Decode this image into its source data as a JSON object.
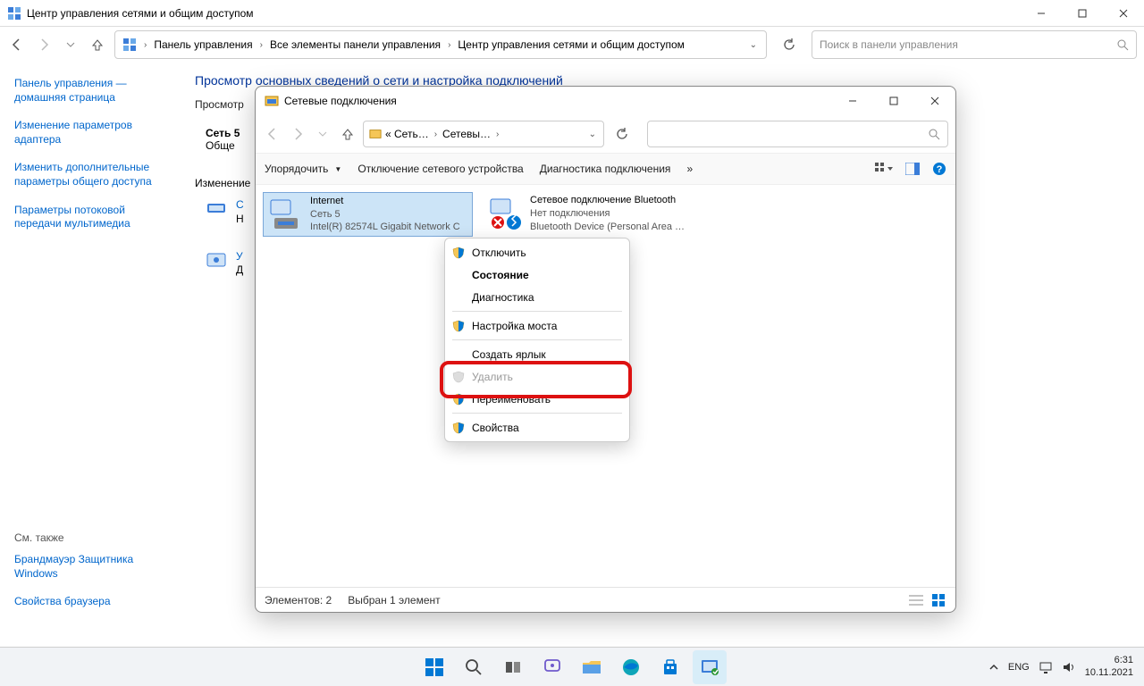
{
  "main_window": {
    "title": "Центр управления сетями и общим доступом",
    "breadcrumb": {
      "level1": "Панель управления",
      "level2": "Все элементы панели управления",
      "level3": "Центр управления сетями и общим доступом"
    },
    "search_placeholder": "Поиск в панели управления"
  },
  "sidebar": {
    "links": [
      "Панель управления — домашняя страница",
      "Изменение параметров адаптера",
      "Изменить дополнительные параметры общего доступа",
      "Параметры потоковой передачи мультимедиа"
    ],
    "footer_title": "См. также",
    "footer_links": [
      "Брандмауэр Защитника Windows",
      "Свойства браузера"
    ]
  },
  "main_content": {
    "heading": "Просмотр основных сведений о сети и настройка подключений",
    "line_view": "Просмотр",
    "net_name": "Сеть 5",
    "net_type": "Обще",
    "section2": "Изменение",
    "frag1": "С",
    "frag2": "Н",
    "frag3": "У",
    "frag4": "Д"
  },
  "inner_window": {
    "title": "Сетевые подключения",
    "crumb1": "« Сеть…",
    "crumb2": "Сетевы…",
    "toolbar": {
      "organize": "Упорядочить",
      "disable": "Отключение сетевого устройства",
      "diag": "Диагностика подключения"
    },
    "connections": [
      {
        "name": "Internet",
        "line2": "Сеть 5",
        "line3": "Intel(R) 82574L Gigabit Network C"
      },
      {
        "name": "Сетевое подключение Bluetooth",
        "line2": "Нет подключения",
        "line3": "Bluetooth Device (Personal Area …"
      }
    ],
    "status": {
      "elements": "Элементов: 2",
      "selected": "Выбран 1 элемент"
    }
  },
  "context_menu": {
    "items": {
      "disable": "Отключить",
      "status": "Состояние",
      "diag": "Диагностика",
      "bridge": "Настройка моста",
      "shortcut": "Создать ярлык",
      "delete": "Удалить",
      "rename": "Переименовать",
      "properties": "Свойства"
    }
  },
  "taskbar": {
    "lang": "ENG",
    "time": "6:31",
    "date": "10.11.2021"
  }
}
